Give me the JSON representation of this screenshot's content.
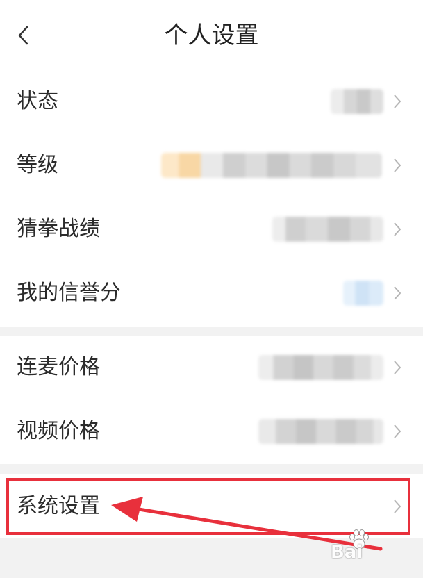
{
  "header": {
    "title": "个人设置",
    "back_icon": "chevron-left-icon"
  },
  "groups": [
    {
      "rows": [
        {
          "label": "状态",
          "value": "redacted"
        },
        {
          "label": "等级",
          "value": "redacted"
        },
        {
          "label": "猜拳战绩",
          "value": "redacted"
        },
        {
          "label": "我的信誉分",
          "value": "redacted"
        }
      ]
    },
    {
      "rows": [
        {
          "label": "连麦价格",
          "value": "redacted"
        },
        {
          "label": "视频价格",
          "value": "redacted"
        }
      ]
    },
    {
      "rows": [
        {
          "label": "系统设置"
        }
      ]
    }
  ],
  "annotation": {
    "highlight_color": "#e8303c",
    "target": "系统设置"
  },
  "watermark": {
    "text": "Bai",
    "icon": "baidu-paw-icon"
  },
  "colors": {
    "background": "#f2f2f2",
    "surface": "#ffffff",
    "text": "#2b2b2b",
    "chevron": "#b5b5b5",
    "accent_red": "#e8303c"
  }
}
